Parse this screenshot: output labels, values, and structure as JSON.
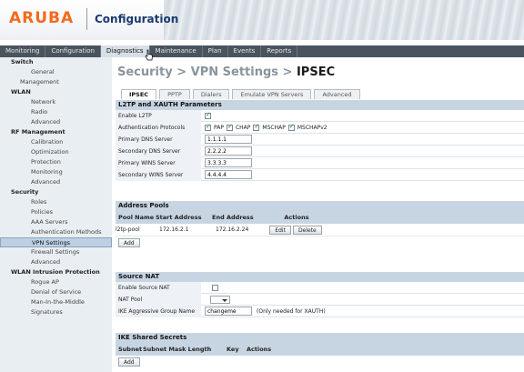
{
  "app": {
    "logo": "ARUBA",
    "title": "Configuration"
  },
  "nav_tabs": [
    "Monitoring",
    "Configuration",
    "Diagnostics",
    "Maintenance",
    "Plan",
    "Events",
    "Reports"
  ],
  "nav_active": "Diagnostics",
  "sidebar": [
    {
      "label": "Switch",
      "type": "head"
    },
    {
      "label": "General",
      "type": "sub"
    },
    {
      "label": "Management",
      "type": "sub2"
    },
    {
      "label": "WLAN",
      "type": "head"
    },
    {
      "label": "Network",
      "type": "sub"
    },
    {
      "label": "Radio",
      "type": "sub"
    },
    {
      "label": "Advanced",
      "type": "sub"
    },
    {
      "label": "RF Management",
      "type": "head"
    },
    {
      "label": "Calibration",
      "type": "sub"
    },
    {
      "label": "Optimization",
      "type": "sub"
    },
    {
      "label": "Protection",
      "type": "sub"
    },
    {
      "label": "Monitoring",
      "type": "sub"
    },
    {
      "label": "Advanced",
      "type": "sub"
    },
    {
      "label": "Security",
      "type": "head"
    },
    {
      "label": "Roles",
      "type": "sub"
    },
    {
      "label": "Policies",
      "type": "sub"
    },
    {
      "label": "AAA Servers",
      "type": "sub"
    },
    {
      "label": "Authentication Methods",
      "type": "sub"
    },
    {
      "label": "VPN Settings",
      "type": "sel"
    },
    {
      "label": "Firewall Settings",
      "type": "sub"
    },
    {
      "label": "Advanced",
      "type": "sub"
    },
    {
      "label": "WLAN Intrusion Protection",
      "type": "head"
    },
    {
      "label": "Rogue AP",
      "type": "sub"
    },
    {
      "label": "Denial of Service",
      "type": "sub"
    },
    {
      "label": "Man-In-the-Middle",
      "type": "sub"
    },
    {
      "label": "Signatures",
      "type": "sub"
    }
  ],
  "page_title": {
    "part1": "Security",
    "sep": " > ",
    "part2": "VPN Settings",
    "part3": "IPSEC"
  },
  "subtabs": [
    "IPSEC",
    "PPTP",
    "Dialers",
    "Emulate VPN Servers",
    "Advanced"
  ],
  "l2tp": {
    "title": "L2TP and XAUTH Parameters",
    "enable_label": "Enable L2TP",
    "auth_label": "Authentication Protocols",
    "protocols": [
      "PAP",
      "CHAP",
      "MSCHAP",
      "MSCHAPv2"
    ],
    "fields": [
      {
        "label": "Primary DNS Server",
        "value": "1.1.1.1"
      },
      {
        "label": "Secondary DNS Server",
        "value": "2.2.2.2"
      },
      {
        "label": "Primary WINS Server",
        "value": "3.3.3.3"
      },
      {
        "label": "Secondary WINS Server",
        "value": "4.4.4.4"
      }
    ]
  },
  "pools": {
    "title": "Address Pools",
    "columns": [
      "Pool Name",
      "Start Address",
      "End Address",
      "Actions"
    ],
    "row": {
      "name": "l2tp-pool",
      "start": "172.16.2.1",
      "end": "172.16.2.24"
    },
    "edit": "Edit",
    "delete": "Delete",
    "add": "Add"
  },
  "nat": {
    "title": "Source NAT",
    "enable_label": "Enable Source NAT",
    "pool_label": "NAT Pool",
    "ike_label": "IKE Aggressive Group Name",
    "ike_value": "changeme",
    "ike_hint": "(Only needed for XAUTH)"
  },
  "ike": {
    "title": "IKE Shared Secrets",
    "columns": [
      "Subnet",
      "Subnet Mask Length",
      "Key",
      "Actions"
    ],
    "add": "Add"
  }
}
